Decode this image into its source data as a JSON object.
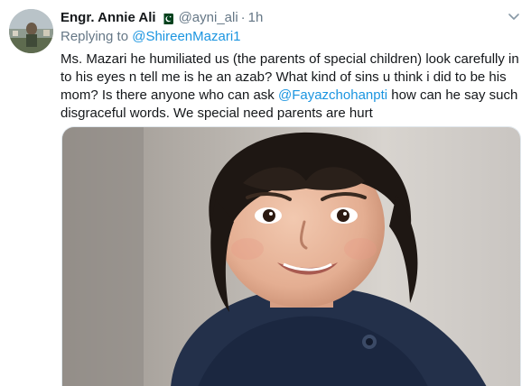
{
  "tweet": {
    "display_name": "Engr. Annie Ali",
    "handle": "@ayni_ali",
    "separator": "·",
    "time": "1h",
    "replying_prefix": "Replying to ",
    "replying_to": "@ShireenMazari1",
    "text_part1": "Ms. Mazari he humiliated us (the parents of special children) look carefully in to his eyes n tell me is he an azab? What kind of sins u think i did to be his mom? Is there anyone who can ask ",
    "text_mention": "@Fayazchohanpti",
    "text_part2": " how can he say such disgraceful words. We special need parents are hurt"
  },
  "icons": {
    "flag": "pakistan-flag-icon",
    "caret": "chevron-down-icon"
  },
  "colors": {
    "mention": "#1b95e0",
    "secondary_text": "#657786",
    "primary_text": "#14171a",
    "flag_green": "#01411c"
  }
}
